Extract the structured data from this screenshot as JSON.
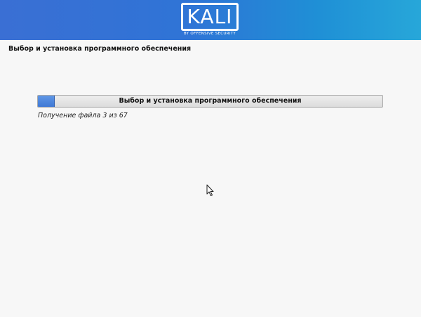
{
  "brand": {
    "logo_text": "KALI",
    "logo_subtitle": "BY OFFENSIVE SECURITY"
  },
  "page": {
    "title": "Выбор и установка программного обеспечения"
  },
  "progress": {
    "label": "Выбор и установка программного обеспечения",
    "fraction": 0.048
  },
  "status": {
    "text": "Получение файла 3 из 67"
  },
  "icons": {
    "cursor": "mouse-pointer-icon"
  }
}
